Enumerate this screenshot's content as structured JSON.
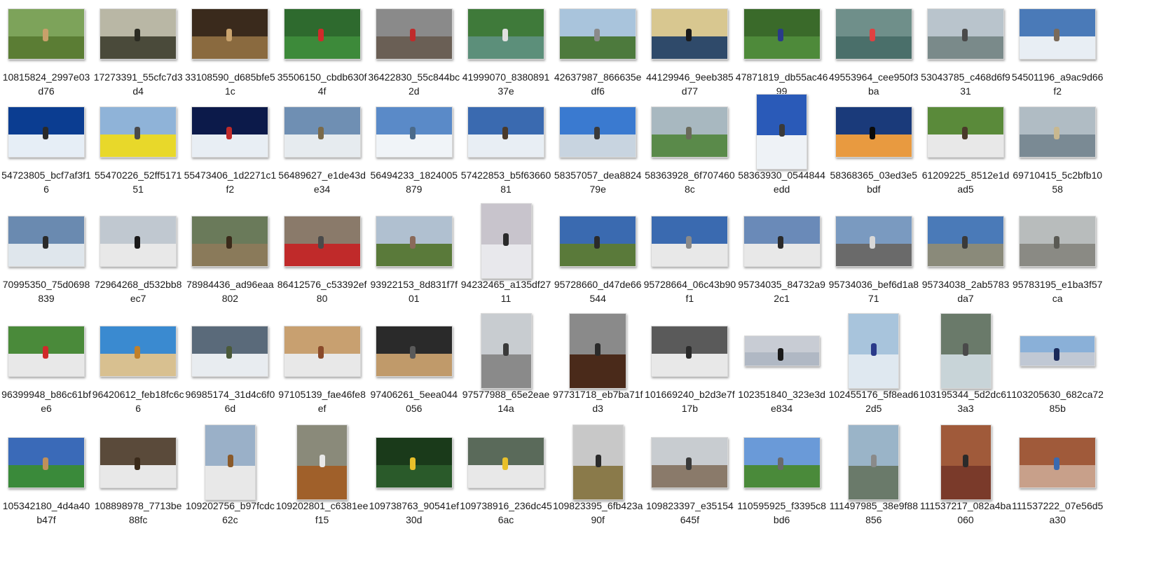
{
  "files": [
    {
      "name": "10815824_2997e03d76",
      "colors": [
        "#7da35a",
        "#5b7d34",
        "#c8a06a"
      ],
      "orient": "landscape"
    },
    {
      "name": "17273391_55cfc7d3d4",
      "colors": [
        "#b9b7a5",
        "#4a4a3a",
        "#2b2b22"
      ],
      "orient": "landscape"
    },
    {
      "name": "33108590_d685bfe51c",
      "colors": [
        "#3a2a1c",
        "#8a6a3f",
        "#c9a36e"
      ],
      "orient": "landscape"
    },
    {
      "name": "35506150_cbdb630f4f",
      "colors": [
        "#2e6a2e",
        "#3d8a3a",
        "#d12a2a"
      ],
      "orient": "landscape"
    },
    {
      "name": "36422830_55c844bc2d",
      "colors": [
        "#8a8a8a",
        "#6a5f55",
        "#c02a2a"
      ],
      "orient": "landscape"
    },
    {
      "name": "41999070_838089137e",
      "colors": [
        "#3f7a3a",
        "#5c8f7a",
        "#e0e0e0"
      ],
      "orient": "landscape"
    },
    {
      "name": "42637987_866635edf6",
      "colors": [
        "#a9c4dc",
        "#4d7a3d",
        "#8a8a8a"
      ],
      "orient": "landscape"
    },
    {
      "name": "44129946_9eeb385d77",
      "colors": [
        "#d8c790",
        "#2f4a6a",
        "#1b1b1b"
      ],
      "orient": "landscape"
    },
    {
      "name": "47871819_db55ac4699",
      "colors": [
        "#3a6a2a",
        "#4e8a3a",
        "#2a3a8a"
      ],
      "orient": "landscape"
    },
    {
      "name": "49553964_cee950f3ba",
      "colors": [
        "#6f8f8a",
        "#4a6f6a",
        "#e04040"
      ],
      "orient": "landscape"
    },
    {
      "name": "53043785_c468d6f931",
      "colors": [
        "#b9c4cc",
        "#7a8a8a",
        "#4a4a4a"
      ],
      "orient": "landscape"
    },
    {
      "name": "54501196_a9ac9d66f2",
      "colors": [
        "#4a7ab8",
        "#e8eef4",
        "#7a6a5a"
      ],
      "orient": "landscape"
    },
    {
      "name": "54723805_bcf7af3f16",
      "colors": [
        "#0b3d91",
        "#e6eef6",
        "#2a2a2a"
      ],
      "orient": "landscape"
    },
    {
      "name": "55470226_52ff517151",
      "colors": [
        "#8fb3d8",
        "#e8d82a",
        "#4a4a4a"
      ],
      "orient": "landscape"
    },
    {
      "name": "55473406_1d2271c1f2",
      "colors": [
        "#0c1a4a",
        "#e8eef4",
        "#c02a2a"
      ],
      "orient": "landscape"
    },
    {
      "name": "56489627_e1de43de34",
      "colors": [
        "#6f8fb3",
        "#e6ebef",
        "#7a6a4a"
      ],
      "orient": "landscape"
    },
    {
      "name": "56494233_1824005879",
      "colors": [
        "#5a8ac8",
        "#f0f4f8",
        "#4a6a8a"
      ],
      "orient": "landscape"
    },
    {
      "name": "57422853_b5f6366081",
      "colors": [
        "#3a6ab0",
        "#e8eef4",
        "#4a3a2a"
      ],
      "orient": "landscape"
    },
    {
      "name": "58357057_dea882479e",
      "colors": [
        "#3a7ad0",
        "#c8d4e0",
        "#3a3a3a"
      ],
      "orient": "landscape"
    },
    {
      "name": "58363928_6f7074608c",
      "colors": [
        "#a8b8c0",
        "#5a8a4a",
        "#6a6a5a"
      ],
      "orient": "landscape"
    },
    {
      "name": "58363930_0544844edd",
      "colors": [
        "#2a5ab8",
        "#eef2f6",
        "#3a3a3a"
      ],
      "orient": "portrait"
    },
    {
      "name": "58368365_03ed3e5bdf",
      "colors": [
        "#1a3a7a",
        "#e89a40",
        "#0a0a0a"
      ],
      "orient": "landscape"
    },
    {
      "name": "61209225_8512e1dad5",
      "colors": [
        "#5a8a3a",
        "#e8e8e8",
        "#4a3a2a"
      ],
      "orient": "landscape"
    },
    {
      "name": "69710415_5c2bfb1058",
      "colors": [
        "#b0bcc4",
        "#7a8a94",
        "#c8b890"
      ],
      "orient": "landscape"
    },
    {
      "name": "70995350_75d0698839",
      "colors": [
        "#6a8ab0",
        "#dfe6ec",
        "#2a2a2a"
      ],
      "orient": "landscape"
    },
    {
      "name": "72964268_d532bb8ec7",
      "colors": [
        "#c0c8d0",
        "#e8e8e8",
        "#1a1a1a"
      ],
      "orient": "landscape"
    },
    {
      "name": "78984436_ad96eaa802",
      "colors": [
        "#6a7a5a",
        "#8a7a5a",
        "#3a2a1a"
      ],
      "orient": "landscape"
    },
    {
      "name": "86412576_c53392ef80",
      "colors": [
        "#8a7a6a",
        "#c02a2a",
        "#4a4a4a"
      ],
      "orient": "landscape"
    },
    {
      "name": "93922153_8d831f7f01",
      "colors": [
        "#b0c0d0",
        "#5a7a3a",
        "#8a6a5a"
      ],
      "orient": "landscape"
    },
    {
      "name": "94232465_a135df2711",
      "colors": [
        "#c8c4cc",
        "#e8e8ec",
        "#2a2a2a"
      ],
      "orient": "portrait"
    },
    {
      "name": "95728660_d47de66544",
      "colors": [
        "#3a6ab0",
        "#5a7a3a",
        "#2a2a2a"
      ],
      "orient": "landscape"
    },
    {
      "name": "95728664_06c43b90f1",
      "colors": [
        "#3a6ab0",
        "#e8e8e8",
        "#8a8a8a"
      ],
      "orient": "landscape"
    },
    {
      "name": "95734035_84732a92c1",
      "colors": [
        "#6a8ab8",
        "#e8e8e8",
        "#2a2a2a"
      ],
      "orient": "landscape"
    },
    {
      "name": "95734036_bef6d1a871",
      "colors": [
        "#7a9ac0",
        "#6a6a6a",
        "#d8d8d8"
      ],
      "orient": "landscape"
    },
    {
      "name": "95734038_2ab5783da7",
      "colors": [
        "#4a7ab8",
        "#8a8a7a",
        "#3a3a3a"
      ],
      "orient": "landscape"
    },
    {
      "name": "95783195_e1ba3f57ca",
      "colors": [
        "#b8bcbc",
        "#8a8a84",
        "#5a5a54"
      ],
      "orient": "landscape"
    },
    {
      "name": "96399948_b86c61bfe6",
      "colors": [
        "#4a8a3a",
        "#e8e8e8",
        "#d02a2a"
      ],
      "orient": "landscape"
    },
    {
      "name": "96420612_feb18fc6c6",
      "colors": [
        "#3a8ad0",
        "#d8c090",
        "#c0802a"
      ],
      "orient": "landscape"
    },
    {
      "name": "96985174_31d4c6f06d",
      "colors": [
        "#5a6a7a",
        "#e8ecf0",
        "#4a5a3a"
      ],
      "orient": "landscape"
    },
    {
      "name": "97105139_fae46fe8ef",
      "colors": [
        "#c8a070",
        "#e8e8e8",
        "#8a4a2a"
      ],
      "orient": "landscape"
    },
    {
      "name": "97406261_5eea044056",
      "colors": [
        "#2a2a2a",
        "#c09a6a",
        "#5a5a5a"
      ],
      "orient": "landscape"
    },
    {
      "name": "97577988_65e2eae14a",
      "colors": [
        "#c8ccd0",
        "#8a8a8a",
        "#3a3a3a"
      ],
      "orient": "portrait"
    },
    {
      "name": "97731718_eb7ba71fd3",
      "colors": [
        "#8a8a8a",
        "#4a2a1a",
        "#2a2a2a"
      ],
      "orient": "square"
    },
    {
      "name": "101669240_b2d3e7f17b",
      "colors": [
        "#5a5a5a",
        "#e8e8e8",
        "#2a2a2a"
      ],
      "orient": "landscape"
    },
    {
      "name": "102351840_323e3de834",
      "colors": [
        "#c8ccd4",
        "#b0b8c4",
        "#1a1a1a"
      ],
      "orient": "wide"
    },
    {
      "name": "102455176_5f8ead62d5",
      "colors": [
        "#a8c4dc",
        "#dfe8f0",
        "#2a3a8a"
      ],
      "orient": "portrait"
    },
    {
      "name": "103195344_5d2dc613a3",
      "colors": [
        "#6a7a6a",
        "#c8d4d8",
        "#4a4a4a"
      ],
      "orient": "portrait"
    },
    {
      "name": "103205630_682ca7285b",
      "colors": [
        "#8ab0d8",
        "#c0c8d4",
        "#1a2a5a"
      ],
      "orient": "wide"
    },
    {
      "name": "105342180_4d4a40b47f",
      "colors": [
        "#3a6ab8",
        "#3a8a3a",
        "#c0905a"
      ],
      "orient": "landscape"
    },
    {
      "name": "108898978_7713be88fc",
      "colors": [
        "#5a4a3a",
        "#e8e8e8",
        "#3a2a1a"
      ],
      "orient": "landscape"
    },
    {
      "name": "109202756_b97fcdc62c",
      "colors": [
        "#9ab0c8",
        "#e8e8e8",
        "#8a5a2a"
      ],
      "orient": "portrait"
    },
    {
      "name": "109202801_c6381eef15",
      "colors": [
        "#8a8a7a",
        "#a0602a",
        "#e8e8e8"
      ],
      "orient": "portrait"
    },
    {
      "name": "109738763_90541ef30d",
      "colors": [
        "#1a3a1a",
        "#2a5a2a",
        "#e8c02a"
      ],
      "orient": "landscape"
    },
    {
      "name": "109738916_236dc456ac",
      "colors": [
        "#5a6a5a",
        "#e8e8e8",
        "#e8c02a"
      ],
      "orient": "landscape"
    },
    {
      "name": "109823395_6fb423a90f",
      "colors": [
        "#c8c8c8",
        "#8a7a4a",
        "#2a2a2a"
      ],
      "orient": "portrait"
    },
    {
      "name": "109823397_e35154645f",
      "colors": [
        "#c8ccd0",
        "#8a7a6a",
        "#3a3a3a"
      ],
      "orient": "landscape"
    },
    {
      "name": "110595925_f3395c8bd6",
      "colors": [
        "#6a9ad8",
        "#4a8a3a",
        "#6a6a6a"
      ],
      "orient": "landscape"
    },
    {
      "name": "111497985_38e9f88856",
      "colors": [
        "#9ab4c8",
        "#6a7a6a",
        "#8a8a8a"
      ],
      "orient": "portrait"
    },
    {
      "name": "111537217_082a4ba060",
      "colors": [
        "#a05a3a",
        "#7a3a2a",
        "#2a2a2a"
      ],
      "orient": "portrait"
    },
    {
      "name": "111537222_07e56d5a30",
      "colors": [
        "#a05a3a",
        "#c8a08a",
        "#3a6ab0"
      ],
      "orient": "landscape"
    }
  ]
}
